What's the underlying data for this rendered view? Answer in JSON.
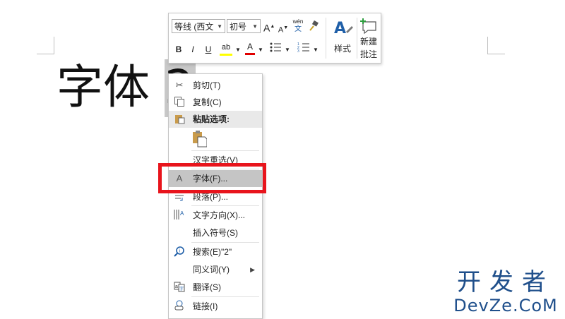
{
  "document": {
    "text_before": "字体 ",
    "selected_text": "2"
  },
  "mini_toolbar": {
    "font_name": "等线 (西文",
    "font_size": "初号",
    "grow_font_label": "A",
    "shrink_font_label": "A",
    "phonetic_top": "wén",
    "phonetic_bottom": "文",
    "bold_label": "B",
    "italic_label": "I",
    "underline_label": "U",
    "highlight_label": "ab",
    "font_color_label": "A",
    "styles_label": "样式",
    "new_comment_label_1": "新建",
    "new_comment_label_2": "批注",
    "colors": {
      "highlight": "#ffff00",
      "font_color": "#e00000"
    }
  },
  "context_menu": {
    "items": [
      {
        "label": "剪切(T)",
        "icon": "scissors-icon"
      },
      {
        "label": "复制(C)",
        "icon": "copy-icon"
      },
      {
        "label": "粘贴选项:",
        "icon": "paste-icon"
      },
      {
        "label": "汉字重选(V)",
        "icon": ""
      },
      {
        "label": "字体(F)...",
        "icon": "font-icon"
      },
      {
        "label": "段落(P)...",
        "icon": "paragraph-icon"
      },
      {
        "label": "文字方向(X)...",
        "icon": "text-direction-icon"
      },
      {
        "label": "插入符号(S)",
        "icon": ""
      },
      {
        "label": "搜索(E)\"2\"",
        "icon": "search-icon"
      },
      {
        "label": "同义词(Y)",
        "icon": "",
        "submenu": "▶"
      },
      {
        "label": "翻译(S)",
        "icon": "translate-icon"
      },
      {
        "label": "链接(I)",
        "icon": "link-icon"
      }
    ],
    "font_item_glyph": "A"
  },
  "watermark": {
    "line1": "开发者",
    "line2": "DevZe.CoM"
  },
  "colors": {
    "highlight_box": "#e8141c",
    "watermark": "#1f4f8b"
  }
}
